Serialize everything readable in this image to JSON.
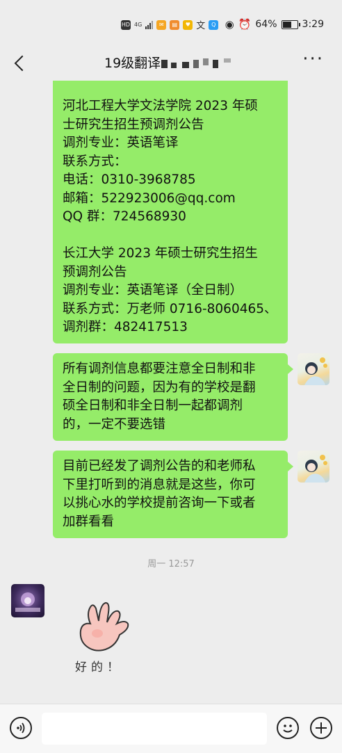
{
  "status_bar": {
    "badges": [
      "HD",
      "4G"
    ],
    "battery": "64%",
    "time": "3:29"
  },
  "header": {
    "title": "19级翻译",
    "more_icon": "more-horizontal-icon",
    "back_icon": "back-chevron-icon"
  },
  "messages": [
    {
      "lines": [
        "河北工程大学文法学院 2023 年硕",
        "士研究生招生预调剂公告",
        "调剂专业：英语笔译",
        "联系方式：",
        "电话：0310-3968785",
        "邮箱：522923006@qq.com",
        "QQ 群：724568930",
        "",
        "长江大学 2023 年硕士研究生招生",
        "预调剂公告",
        "调剂专业：英语笔译（全日制）",
        "联系方式：万老师 0716-8060465、",
        "调剂群：482417513"
      ]
    },
    {
      "lines": [
        "所有调剂信息都要注意全日制和非",
        "全日制的问题，因为有的学校是翻",
        "硕全日制和非全日制一起都调剂",
        "的，一定不要选错"
      ]
    },
    {
      "lines": [
        "目前已经发了调剂公告的和老师私",
        "下里打听到的消息就是这些，你可",
        "以挑心水的学校提前咨询一下或者",
        "加群看看"
      ]
    }
  ],
  "timestamp": "周一 12:57",
  "sticker": {
    "text": "好的！"
  },
  "bottom_bar": {
    "input_value": "",
    "voice_icon": "voice-icon",
    "emoji_icon": "emoji-icon",
    "plus_icon": "plus-icon"
  },
  "colors": {
    "bubble": "#95ec69",
    "background": "#ededed"
  }
}
